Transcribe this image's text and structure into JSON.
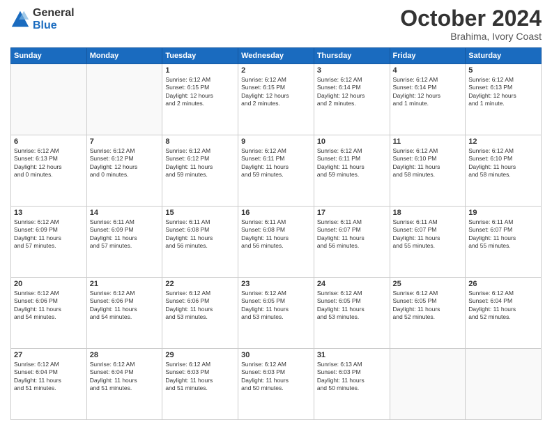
{
  "header": {
    "logo_general": "General",
    "logo_blue": "Blue",
    "month": "October 2024",
    "location": "Brahima, Ivory Coast"
  },
  "weekdays": [
    "Sunday",
    "Monday",
    "Tuesday",
    "Wednesday",
    "Thursday",
    "Friday",
    "Saturday"
  ],
  "weeks": [
    [
      {
        "day": "",
        "text": ""
      },
      {
        "day": "",
        "text": ""
      },
      {
        "day": "1",
        "text": "Sunrise: 6:12 AM\nSunset: 6:15 PM\nDaylight: 12 hours\nand 2 minutes."
      },
      {
        "day": "2",
        "text": "Sunrise: 6:12 AM\nSunset: 6:15 PM\nDaylight: 12 hours\nand 2 minutes."
      },
      {
        "day": "3",
        "text": "Sunrise: 6:12 AM\nSunset: 6:14 PM\nDaylight: 12 hours\nand 2 minutes."
      },
      {
        "day": "4",
        "text": "Sunrise: 6:12 AM\nSunset: 6:14 PM\nDaylight: 12 hours\nand 1 minute."
      },
      {
        "day": "5",
        "text": "Sunrise: 6:12 AM\nSunset: 6:13 PM\nDaylight: 12 hours\nand 1 minute."
      }
    ],
    [
      {
        "day": "6",
        "text": "Sunrise: 6:12 AM\nSunset: 6:13 PM\nDaylight: 12 hours\nand 0 minutes."
      },
      {
        "day": "7",
        "text": "Sunrise: 6:12 AM\nSunset: 6:12 PM\nDaylight: 12 hours\nand 0 minutes."
      },
      {
        "day": "8",
        "text": "Sunrise: 6:12 AM\nSunset: 6:12 PM\nDaylight: 11 hours\nand 59 minutes."
      },
      {
        "day": "9",
        "text": "Sunrise: 6:12 AM\nSunset: 6:11 PM\nDaylight: 11 hours\nand 59 minutes."
      },
      {
        "day": "10",
        "text": "Sunrise: 6:12 AM\nSunset: 6:11 PM\nDaylight: 11 hours\nand 59 minutes."
      },
      {
        "day": "11",
        "text": "Sunrise: 6:12 AM\nSunset: 6:10 PM\nDaylight: 11 hours\nand 58 minutes."
      },
      {
        "day": "12",
        "text": "Sunrise: 6:12 AM\nSunset: 6:10 PM\nDaylight: 11 hours\nand 58 minutes."
      }
    ],
    [
      {
        "day": "13",
        "text": "Sunrise: 6:12 AM\nSunset: 6:09 PM\nDaylight: 11 hours\nand 57 minutes."
      },
      {
        "day": "14",
        "text": "Sunrise: 6:11 AM\nSunset: 6:09 PM\nDaylight: 11 hours\nand 57 minutes."
      },
      {
        "day": "15",
        "text": "Sunrise: 6:11 AM\nSunset: 6:08 PM\nDaylight: 11 hours\nand 56 minutes."
      },
      {
        "day": "16",
        "text": "Sunrise: 6:11 AM\nSunset: 6:08 PM\nDaylight: 11 hours\nand 56 minutes."
      },
      {
        "day": "17",
        "text": "Sunrise: 6:11 AM\nSunset: 6:07 PM\nDaylight: 11 hours\nand 56 minutes."
      },
      {
        "day": "18",
        "text": "Sunrise: 6:11 AM\nSunset: 6:07 PM\nDaylight: 11 hours\nand 55 minutes."
      },
      {
        "day": "19",
        "text": "Sunrise: 6:11 AM\nSunset: 6:07 PM\nDaylight: 11 hours\nand 55 minutes."
      }
    ],
    [
      {
        "day": "20",
        "text": "Sunrise: 6:12 AM\nSunset: 6:06 PM\nDaylight: 11 hours\nand 54 minutes."
      },
      {
        "day": "21",
        "text": "Sunrise: 6:12 AM\nSunset: 6:06 PM\nDaylight: 11 hours\nand 54 minutes."
      },
      {
        "day": "22",
        "text": "Sunrise: 6:12 AM\nSunset: 6:06 PM\nDaylight: 11 hours\nand 53 minutes."
      },
      {
        "day": "23",
        "text": "Sunrise: 6:12 AM\nSunset: 6:05 PM\nDaylight: 11 hours\nand 53 minutes."
      },
      {
        "day": "24",
        "text": "Sunrise: 6:12 AM\nSunset: 6:05 PM\nDaylight: 11 hours\nand 53 minutes."
      },
      {
        "day": "25",
        "text": "Sunrise: 6:12 AM\nSunset: 6:05 PM\nDaylight: 11 hours\nand 52 minutes."
      },
      {
        "day": "26",
        "text": "Sunrise: 6:12 AM\nSunset: 6:04 PM\nDaylight: 11 hours\nand 52 minutes."
      }
    ],
    [
      {
        "day": "27",
        "text": "Sunrise: 6:12 AM\nSunset: 6:04 PM\nDaylight: 11 hours\nand 51 minutes."
      },
      {
        "day": "28",
        "text": "Sunrise: 6:12 AM\nSunset: 6:04 PM\nDaylight: 11 hours\nand 51 minutes."
      },
      {
        "day": "29",
        "text": "Sunrise: 6:12 AM\nSunset: 6:03 PM\nDaylight: 11 hours\nand 51 minutes."
      },
      {
        "day": "30",
        "text": "Sunrise: 6:12 AM\nSunset: 6:03 PM\nDaylight: 11 hours\nand 50 minutes."
      },
      {
        "day": "31",
        "text": "Sunrise: 6:13 AM\nSunset: 6:03 PM\nDaylight: 11 hours\nand 50 minutes."
      },
      {
        "day": "",
        "text": ""
      },
      {
        "day": "",
        "text": ""
      }
    ]
  ]
}
